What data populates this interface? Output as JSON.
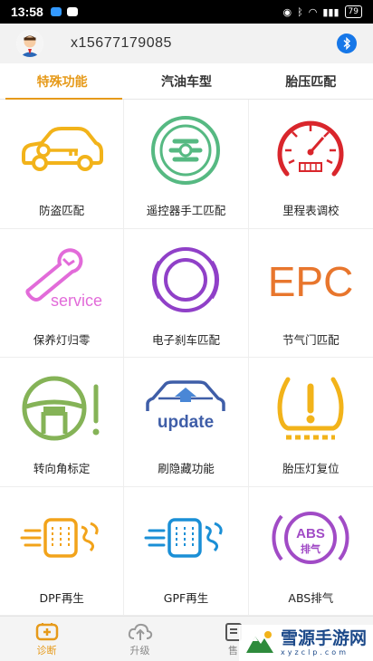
{
  "status_bar": {
    "time": "13:58",
    "battery": "79"
  },
  "header": {
    "user_id": "x15677179085",
    "avatar_icon": "user-avatar-icon",
    "bluetooth_icon": "bluetooth-icon"
  },
  "tabs": [
    {
      "label": "特殊功能",
      "active": true
    },
    {
      "label": "汽油车型",
      "active": false
    },
    {
      "label": "胎压匹配",
      "active": false
    }
  ],
  "functions": [
    {
      "label": "防盗匹配",
      "icon": "car-key-icon",
      "color": "#f2b31a"
    },
    {
      "label": "遥控器手工匹配",
      "icon": "remote-match-icon",
      "color": "#56b982"
    },
    {
      "label": "里程表调校",
      "icon": "odometer-icon",
      "color": "#d9262c"
    },
    {
      "label": "保养灯归零",
      "icon": "service-wrench-icon",
      "icon_text": "service",
      "color": "#e26bd9"
    },
    {
      "label": "电子刹车匹配",
      "icon": "electronic-brake-icon",
      "color": "#9040c8"
    },
    {
      "label": "节气门匹配",
      "icon": "epc-throttle-icon",
      "icon_text": "EPC",
      "color": "#e8762d"
    },
    {
      "label": "转向角标定",
      "icon": "steering-angle-icon",
      "color": "#85b357"
    },
    {
      "label": "刷隐藏功能",
      "icon": "update-car-icon",
      "icon_text": "update",
      "color": "#3f5ea8"
    },
    {
      "label": "胎压灯复位",
      "icon": "tire-pressure-icon",
      "color": "#f2b31a"
    },
    {
      "label": "DPF再生",
      "icon": "dpf-icon",
      "color": "#f2a31a"
    },
    {
      "label": "GPF再生",
      "icon": "gpf-icon",
      "color": "#1a8fd6"
    },
    {
      "label": "ABS排气",
      "icon": "abs-icon",
      "icon_text": "ABS",
      "icon_subtext": "排气",
      "color": "#a14bc6"
    }
  ],
  "bottom_nav": [
    {
      "label": "诊断",
      "icon": "diagnose-icon",
      "active": true
    },
    {
      "label": "升级",
      "icon": "upload-cloud-icon",
      "active": false
    },
    {
      "label": "售",
      "icon": "document-icon",
      "active": false
    },
    {
      "label": "",
      "icon": "profile-icon",
      "active": false
    }
  ],
  "watermark": {
    "title": "雪源手游网",
    "sub": "xyzclp.com"
  },
  "colors": {
    "accent": "#e69a1a",
    "bluetooth": "#1677e8"
  }
}
